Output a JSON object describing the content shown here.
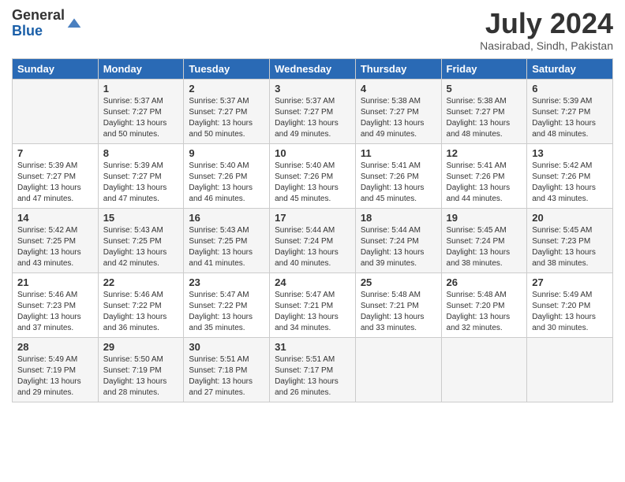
{
  "header": {
    "logo_general": "General",
    "logo_blue": "Blue",
    "month_title": "July 2024",
    "location": "Nasirabad, Sindh, Pakistan"
  },
  "days_of_week": [
    "Sunday",
    "Monday",
    "Tuesday",
    "Wednesday",
    "Thursday",
    "Friday",
    "Saturday"
  ],
  "weeks": [
    [
      {
        "day": "",
        "info": ""
      },
      {
        "day": "1",
        "info": "Sunrise: 5:37 AM\nSunset: 7:27 PM\nDaylight: 13 hours\nand 50 minutes."
      },
      {
        "day": "2",
        "info": "Sunrise: 5:37 AM\nSunset: 7:27 PM\nDaylight: 13 hours\nand 50 minutes."
      },
      {
        "day": "3",
        "info": "Sunrise: 5:37 AM\nSunset: 7:27 PM\nDaylight: 13 hours\nand 49 minutes."
      },
      {
        "day": "4",
        "info": "Sunrise: 5:38 AM\nSunset: 7:27 PM\nDaylight: 13 hours\nand 49 minutes."
      },
      {
        "day": "5",
        "info": "Sunrise: 5:38 AM\nSunset: 7:27 PM\nDaylight: 13 hours\nand 48 minutes."
      },
      {
        "day": "6",
        "info": "Sunrise: 5:39 AM\nSunset: 7:27 PM\nDaylight: 13 hours\nand 48 minutes."
      }
    ],
    [
      {
        "day": "7",
        "info": "Sunrise: 5:39 AM\nSunset: 7:27 PM\nDaylight: 13 hours\nand 47 minutes."
      },
      {
        "day": "8",
        "info": "Sunrise: 5:39 AM\nSunset: 7:27 PM\nDaylight: 13 hours\nand 47 minutes."
      },
      {
        "day": "9",
        "info": "Sunrise: 5:40 AM\nSunset: 7:26 PM\nDaylight: 13 hours\nand 46 minutes."
      },
      {
        "day": "10",
        "info": "Sunrise: 5:40 AM\nSunset: 7:26 PM\nDaylight: 13 hours\nand 45 minutes."
      },
      {
        "day": "11",
        "info": "Sunrise: 5:41 AM\nSunset: 7:26 PM\nDaylight: 13 hours\nand 45 minutes."
      },
      {
        "day": "12",
        "info": "Sunrise: 5:41 AM\nSunset: 7:26 PM\nDaylight: 13 hours\nand 44 minutes."
      },
      {
        "day": "13",
        "info": "Sunrise: 5:42 AM\nSunset: 7:26 PM\nDaylight: 13 hours\nand 43 minutes."
      }
    ],
    [
      {
        "day": "14",
        "info": "Sunrise: 5:42 AM\nSunset: 7:25 PM\nDaylight: 13 hours\nand 43 minutes."
      },
      {
        "day": "15",
        "info": "Sunrise: 5:43 AM\nSunset: 7:25 PM\nDaylight: 13 hours\nand 42 minutes."
      },
      {
        "day": "16",
        "info": "Sunrise: 5:43 AM\nSunset: 7:25 PM\nDaylight: 13 hours\nand 41 minutes."
      },
      {
        "day": "17",
        "info": "Sunrise: 5:44 AM\nSunset: 7:24 PM\nDaylight: 13 hours\nand 40 minutes."
      },
      {
        "day": "18",
        "info": "Sunrise: 5:44 AM\nSunset: 7:24 PM\nDaylight: 13 hours\nand 39 minutes."
      },
      {
        "day": "19",
        "info": "Sunrise: 5:45 AM\nSunset: 7:24 PM\nDaylight: 13 hours\nand 38 minutes."
      },
      {
        "day": "20",
        "info": "Sunrise: 5:45 AM\nSunset: 7:23 PM\nDaylight: 13 hours\nand 38 minutes."
      }
    ],
    [
      {
        "day": "21",
        "info": "Sunrise: 5:46 AM\nSunset: 7:23 PM\nDaylight: 13 hours\nand 37 minutes."
      },
      {
        "day": "22",
        "info": "Sunrise: 5:46 AM\nSunset: 7:22 PM\nDaylight: 13 hours\nand 36 minutes."
      },
      {
        "day": "23",
        "info": "Sunrise: 5:47 AM\nSunset: 7:22 PM\nDaylight: 13 hours\nand 35 minutes."
      },
      {
        "day": "24",
        "info": "Sunrise: 5:47 AM\nSunset: 7:21 PM\nDaylight: 13 hours\nand 34 minutes."
      },
      {
        "day": "25",
        "info": "Sunrise: 5:48 AM\nSunset: 7:21 PM\nDaylight: 13 hours\nand 33 minutes."
      },
      {
        "day": "26",
        "info": "Sunrise: 5:48 AM\nSunset: 7:20 PM\nDaylight: 13 hours\nand 32 minutes."
      },
      {
        "day": "27",
        "info": "Sunrise: 5:49 AM\nSunset: 7:20 PM\nDaylight: 13 hours\nand 30 minutes."
      }
    ],
    [
      {
        "day": "28",
        "info": "Sunrise: 5:49 AM\nSunset: 7:19 PM\nDaylight: 13 hours\nand 29 minutes."
      },
      {
        "day": "29",
        "info": "Sunrise: 5:50 AM\nSunset: 7:19 PM\nDaylight: 13 hours\nand 28 minutes."
      },
      {
        "day": "30",
        "info": "Sunrise: 5:51 AM\nSunset: 7:18 PM\nDaylight: 13 hours\nand 27 minutes."
      },
      {
        "day": "31",
        "info": "Sunrise: 5:51 AM\nSunset: 7:17 PM\nDaylight: 13 hours\nand 26 minutes."
      },
      {
        "day": "",
        "info": ""
      },
      {
        "day": "",
        "info": ""
      },
      {
        "day": "",
        "info": ""
      }
    ]
  ]
}
